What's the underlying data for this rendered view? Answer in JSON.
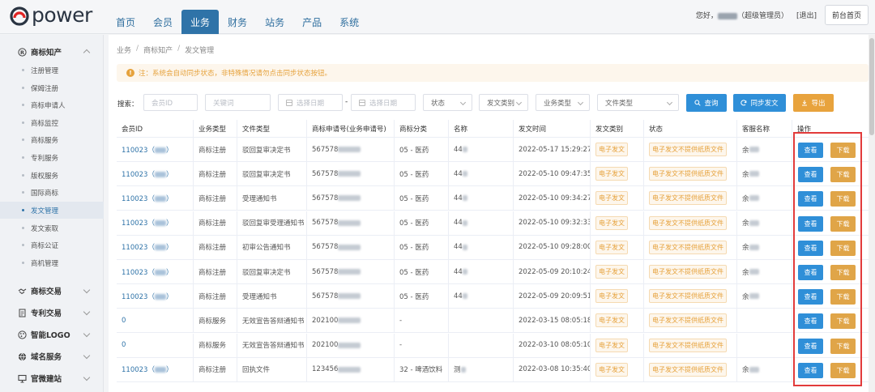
{
  "header": {
    "logo_text": "power",
    "nav": [
      "首页",
      "会员",
      "业务",
      "财务",
      "站务",
      "产品",
      "系统"
    ],
    "active_nav": 2,
    "greeting_prefix": "您好，",
    "greeting_suffix": "（超级管理员）",
    "logout": "[退出]",
    "front_btn": "前台首页"
  },
  "sidebar": {
    "group1": "商标知产",
    "items": [
      "注册管理",
      "保姆注册",
      "商标申请人",
      "商标监控",
      "商标服务",
      "专利服务",
      "版权服务",
      "国际商标",
      "发文管理",
      "发文索取",
      "商标公证",
      "商机管理"
    ],
    "active_item": 8,
    "groups": [
      "商标交易",
      "专利交易",
      "智能LOGO",
      "域名服务",
      "官微建站"
    ]
  },
  "breadcrumb": [
    "业务",
    "商标知产",
    "发文管理"
  ],
  "notice": "注：系统会自动同步状态，非特殊情况请勿点击同步状态按钮。",
  "filters": {
    "label": "搜索：",
    "member_id_ph": "会员ID",
    "keyword_ph": "关键词",
    "start_date_ph": "选择日期",
    "end_date_ph": "选择日期",
    "dash": "-",
    "status": "状态",
    "doc_category": "发文类别",
    "biz_type": "业务类型",
    "file_type": "文件类型",
    "query_btn": "查询",
    "sync_btn": "同步发文",
    "export_btn": "导出"
  },
  "table": {
    "headers": [
      "会员ID",
      "业务类型",
      "文件类型",
      "商标申请号(业务申请号)",
      "商标分类",
      "名称",
      "发文时间",
      "发文类别",
      "状态",
      "客服名称",
      "操作"
    ],
    "view_label": "查看",
    "download_label": "下载",
    "rows": [
      {
        "member": "110023（",
        "member_end": "）",
        "blur_member": true,
        "biz": "商标注册",
        "file": "驳回复审决定书",
        "app_no": "567578",
        "blur_app": true,
        "cls": "05 - 医药",
        "name": "44",
        "blur_name": true,
        "time": "2022-05-17 15:29:27",
        "cat": "电子发文",
        "status": "电子发文不提供纸质文件",
        "cs": "余",
        "blur_cs": true
      },
      {
        "member": "110023（",
        "member_end": "）",
        "blur_member": true,
        "biz": "商标注册",
        "file": "驳回复审决定书",
        "app_no": "567578",
        "blur_app": true,
        "cls": "05 - 医药",
        "name": "44",
        "blur_name": true,
        "time": "2022-05-10 09:47:35",
        "cat": "电子发文",
        "status": "电子发文不提供纸质文件",
        "cs": "余",
        "blur_cs": true
      },
      {
        "member": "110023（",
        "member_end": "）",
        "blur_member": true,
        "biz": "商标注册",
        "file": "受理通知书",
        "app_no": "567578",
        "blur_app": true,
        "cls": "05 - 医药",
        "name": "44",
        "blur_name": true,
        "time": "2022-05-10 09:34:27",
        "cat": "电子发文",
        "status": "电子发文不提供纸质文件",
        "cs": "余",
        "blur_cs": true
      },
      {
        "member": "110023（",
        "member_end": "）",
        "blur_member": true,
        "biz": "商标注册",
        "file": "驳回复审受理通知书",
        "app_no": "567578",
        "blur_app": true,
        "cls": "05 - 医药",
        "name": "44",
        "blur_name": true,
        "time": "2022-05-10 09:32:33",
        "cat": "电子发文",
        "status": "电子发文不提供纸质文件",
        "cs": "余",
        "blur_cs": true
      },
      {
        "member": "110023（",
        "member_end": "）",
        "blur_member": true,
        "biz": "商标注册",
        "file": "初审公告通知书",
        "app_no": "567578",
        "blur_app": true,
        "cls": "05 - 医药",
        "name": "44",
        "blur_name": true,
        "time": "2022-05-10 09:28:00",
        "cat": "电子发文",
        "status": "电子发文不提供纸质文件",
        "cs": "余",
        "blur_cs": true
      },
      {
        "member": "110023（",
        "member_end": "）",
        "blur_member": true,
        "biz": "商标注册",
        "file": "驳回复审决定书",
        "app_no": "567578",
        "blur_app": true,
        "cls": "05 - 医药",
        "name": "44",
        "blur_name": true,
        "time": "2022-05-09 20:10:24",
        "cat": "电子发文",
        "status": "电子发文不提供纸质文件",
        "cs": "余",
        "blur_cs": true
      },
      {
        "member": "110023（",
        "member_end": "）",
        "blur_member": true,
        "biz": "商标注册",
        "file": "受理通知书",
        "app_no": "567578",
        "blur_app": true,
        "cls": "05 - 医药",
        "name": "44",
        "blur_name": true,
        "time": "2022-05-09 20:09:51",
        "cat": "电子发文",
        "status": "电子发文不提供纸质文件",
        "cs": "余",
        "blur_cs": true
      },
      {
        "member": "0",
        "member_end": "",
        "blur_member": false,
        "biz": "商标服务",
        "file": "无效宣告答辩通知书",
        "app_no": "202100",
        "blur_app": true,
        "cls": "-",
        "name": "",
        "blur_name": false,
        "time": "2022-03-15 08:05:18",
        "cat": "电子发文",
        "status": "电子发文不提供纸质文件",
        "cs": "",
        "blur_cs": false
      },
      {
        "member": "0",
        "member_end": "",
        "blur_member": false,
        "biz": "商标服务",
        "file": "无效宣告答辩通知书",
        "app_no": "202100",
        "blur_app": true,
        "cls": "-",
        "name": "",
        "blur_name": false,
        "time": "2022-03-10 08:05:10",
        "cat": "电子发文",
        "status": "电子发文不提供纸质文件",
        "cs": "",
        "blur_cs": false
      },
      {
        "member": "110023（",
        "member_end": "）",
        "blur_member": true,
        "biz": "商标注册",
        "file": "回执文件",
        "app_no": "123456",
        "blur_app": true,
        "cls": "32 - 啤酒饮料",
        "name": "测",
        "blur_name": true,
        "time": "2022-03-08 10:35:40",
        "cat": "电子发文",
        "status": "电子发文不提供纸质文件",
        "cs": "余",
        "blur_cs": true
      }
    ]
  },
  "colors": {
    "primary": "#2f73a8",
    "button_blue": "#2f8fd8",
    "button_orange": "#e0a548",
    "tag_orange": "#e6a23c",
    "highlight_red": "#e23b3b"
  }
}
